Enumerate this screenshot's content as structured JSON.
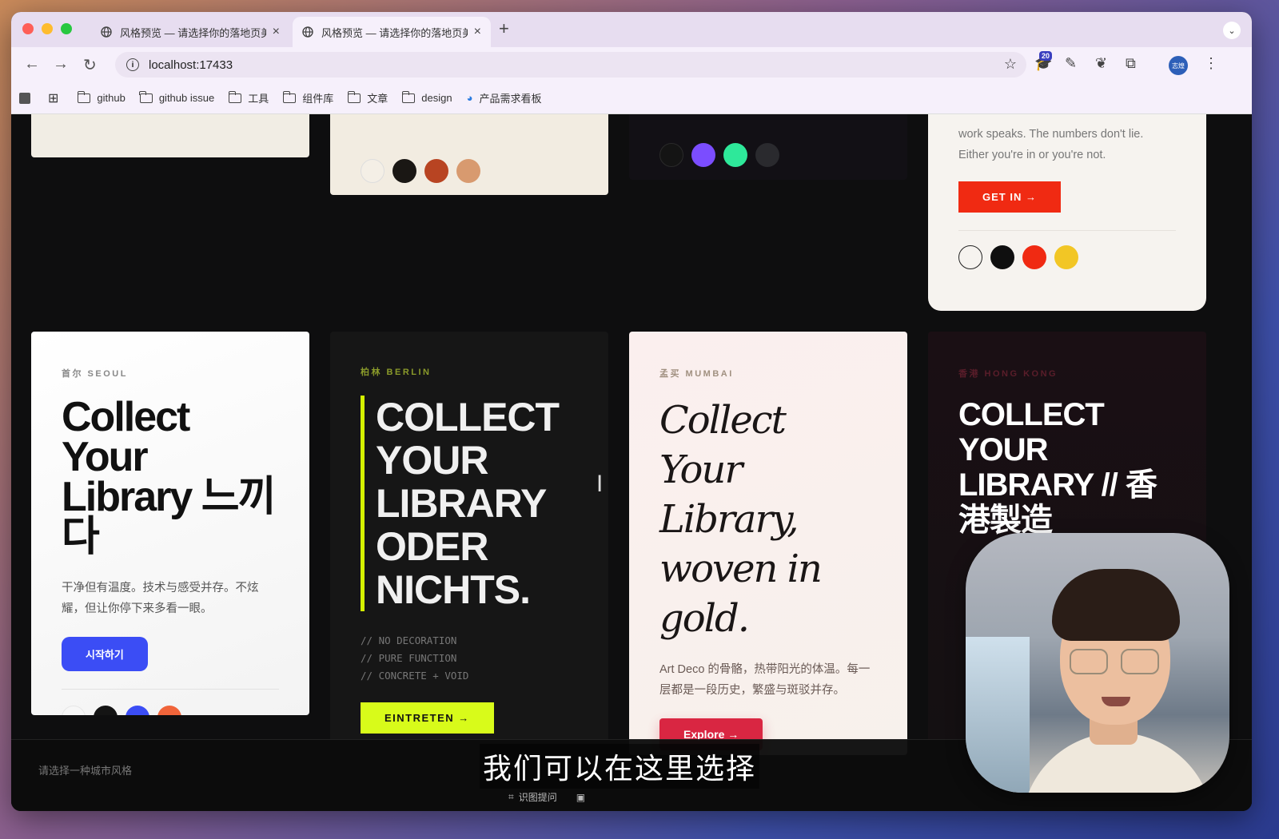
{
  "browser": {
    "tabs": [
      {
        "title": "风格预览 — 请选择你的落地页美",
        "active": false
      },
      {
        "title": "风格预览 — 请选择你的落地页美",
        "active": true
      }
    ],
    "url": "localhost:17433",
    "extension_badge": "20",
    "profile_label": "志煌",
    "bookmarks": [
      "github",
      "github issue",
      "工具",
      "组件库",
      "文章",
      "design",
      "产品需求看板"
    ]
  },
  "top_cards": {
    "card4_text": "work speaks. The numbers don't lie. Either you're in or you're not.",
    "card4_button": "GET IN →",
    "card1_swatches": [],
    "card2_swatches": [
      "#f4efe6",
      "#1a1714",
      "#b84422",
      "#d89a6f"
    ],
    "card3_swatches": [
      "#141414",
      "#7b4dff",
      "#2ee89a",
      "#2a2a2e"
    ],
    "card4_swatches": [
      "#f6f3ef",
      "#0f0f0f",
      "#f02a12",
      "#f2c625"
    ]
  },
  "cards": {
    "seoul": {
      "label": "首尔 SEOUL",
      "heading": "Collect Your Library 느끼다",
      "text": "干净但有温度。技术与感受并存。不炫耀，但让你停下来多看一眼。",
      "button": "시작하기",
      "swatches": [
        "#f7f7f7",
        "#141414",
        "#3b4df5",
        "#f0643a"
      ]
    },
    "berlin": {
      "label": "柏林 BERLIN",
      "heading": "COLLECT YOUR LIBRARY ODER NICHTS.",
      "code_lines": [
        "// NO DECORATION",
        "// PURE FUNCTION",
        "// CONCRETE + VOID"
      ],
      "button": "EINTRETEN →"
    },
    "mumbai": {
      "label": "孟买 MUMBAI",
      "heading": "Collect Your Library, woven in gold.",
      "text": "Art Deco 的骨骼，热带阳光的体温。每一层都是一段历史，繁盛与斑驳并存。",
      "button": "Explore →",
      "swatches": [
        "#fbf3ee",
        "#1a1414",
        "#d92642",
        "#ebc38e"
      ]
    },
    "hongkong": {
      "label": "香港 HONG KONG",
      "heading": "COLLECT YOUR LIBRARY // 香港製造"
    }
  },
  "footer": {
    "prompt": "请选择一种城市风格"
  },
  "overlay": {
    "subtitle": "我们可以在这里选择",
    "ocr_label": "识图提问"
  }
}
